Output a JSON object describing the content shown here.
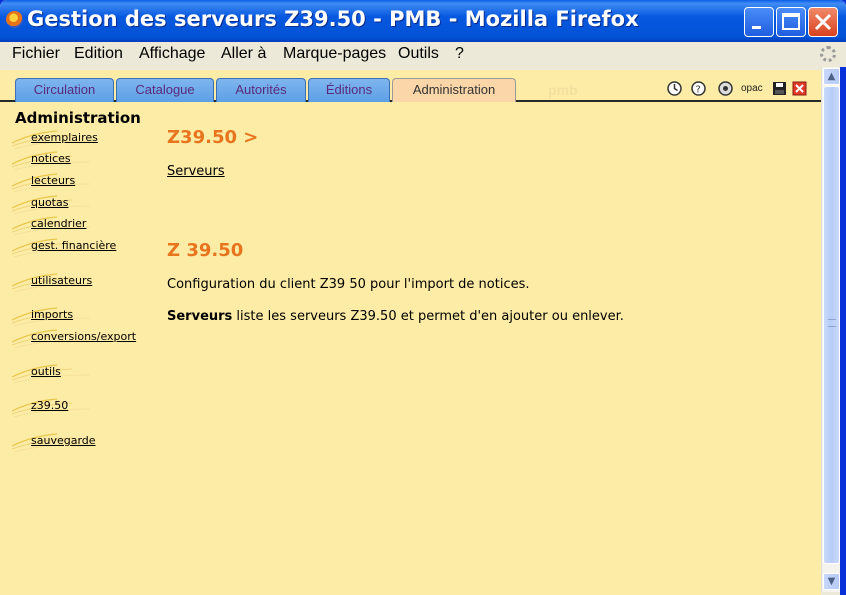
{
  "window": {
    "title": "Gestion des serveurs Z39.50 - PMB - Mozilla Firefox",
    "buttons": [
      "minimize",
      "maximize",
      "close"
    ]
  },
  "menubar": [
    "Fichier",
    "Edition",
    "Affichage",
    "Aller à",
    "Marque-pages",
    "Outils",
    "?"
  ],
  "tabs": [
    {
      "label": "Circulation",
      "active": false
    },
    {
      "label": "Catalogue",
      "active": false
    },
    {
      "label": "Autorités",
      "active": false
    },
    {
      "label": "Éditions",
      "active": false
    },
    {
      "label": "Administration",
      "active": true
    }
  ],
  "toolbar_icons": [
    "clock-icon",
    "help-icon",
    "settings-icon",
    "opac-icon",
    "save-icon",
    "close-icon"
  ],
  "opac_label": "opac",
  "ghost_logo": "pmb",
  "sidebar": {
    "title": "Administration",
    "items": [
      "exemplaires",
      "notices",
      "lecteurs",
      "quotas",
      "calendrier",
      "gest. financière",
      "utilisateurs",
      "imports",
      "conversions/export",
      "outils",
      "z39.50",
      "sauvegarde"
    ]
  },
  "main": {
    "section_heading": "Z39.50 >",
    "link": "Serveurs",
    "heading2": "Z 39.50",
    "description": "Configuration du client Z39 50 pour l'import de notices.",
    "servers_bold": "Serveurs",
    "servers_rest": " liste les serveurs Z39.50 et permet d'en ajouter ou enlever."
  },
  "colors": {
    "content_bg": "#fdeca6",
    "heading_orange": "#e8741e",
    "tab_blue": "#6aa8ea",
    "tab_active": "#fbd6a8",
    "titlebar_blue": "#0353d6"
  }
}
